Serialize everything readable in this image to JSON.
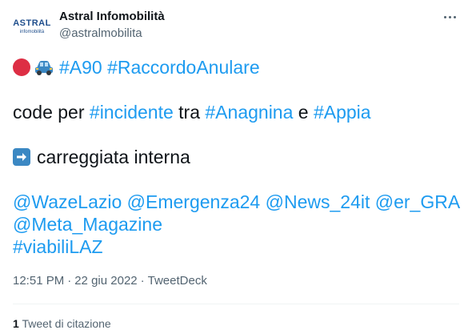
{
  "author": {
    "display_name": "Astral Infomobilità",
    "handle": "@astralmobilita",
    "avatar_text_top": "ASTRAL",
    "avatar_text_bottom": "infomobilità"
  },
  "tweet": {
    "line1": {
      "emoji": [
        "red-circle-icon",
        "car-icon"
      ],
      "hashtags": [
        "#A90",
        "#RaccordoAnulare"
      ]
    },
    "line2": {
      "text_before": "code per ",
      "hashtag1": "#incidente",
      "text_middle": " tra ",
      "hashtag2": "#Anagnina",
      "text_and": " e ",
      "hashtag3": "#Appia"
    },
    "line3": {
      "emoji": "right-arrow-icon",
      "text": "carreggiata interna"
    },
    "mentions_line1": [
      "@WazeLazio",
      "@Emergenza24",
      "@News_24it",
      "@er_GRA"
    ],
    "mentions_line2": "@Meta_Magazine",
    "hashtag_last": "#viabiliLAZ"
  },
  "meta": {
    "time": "12:51 PM",
    "separator": "·",
    "date": "22 giu 2022",
    "source": "TweetDeck"
  },
  "stats": {
    "quote_count": "1",
    "quote_label": "Tweet di citazione"
  },
  "colors": {
    "link": "#1d9bf0",
    "text": "#0f1419",
    "secondary": "#536471",
    "divider": "#eff3f4",
    "brand_blue": "#1f4e8c"
  }
}
